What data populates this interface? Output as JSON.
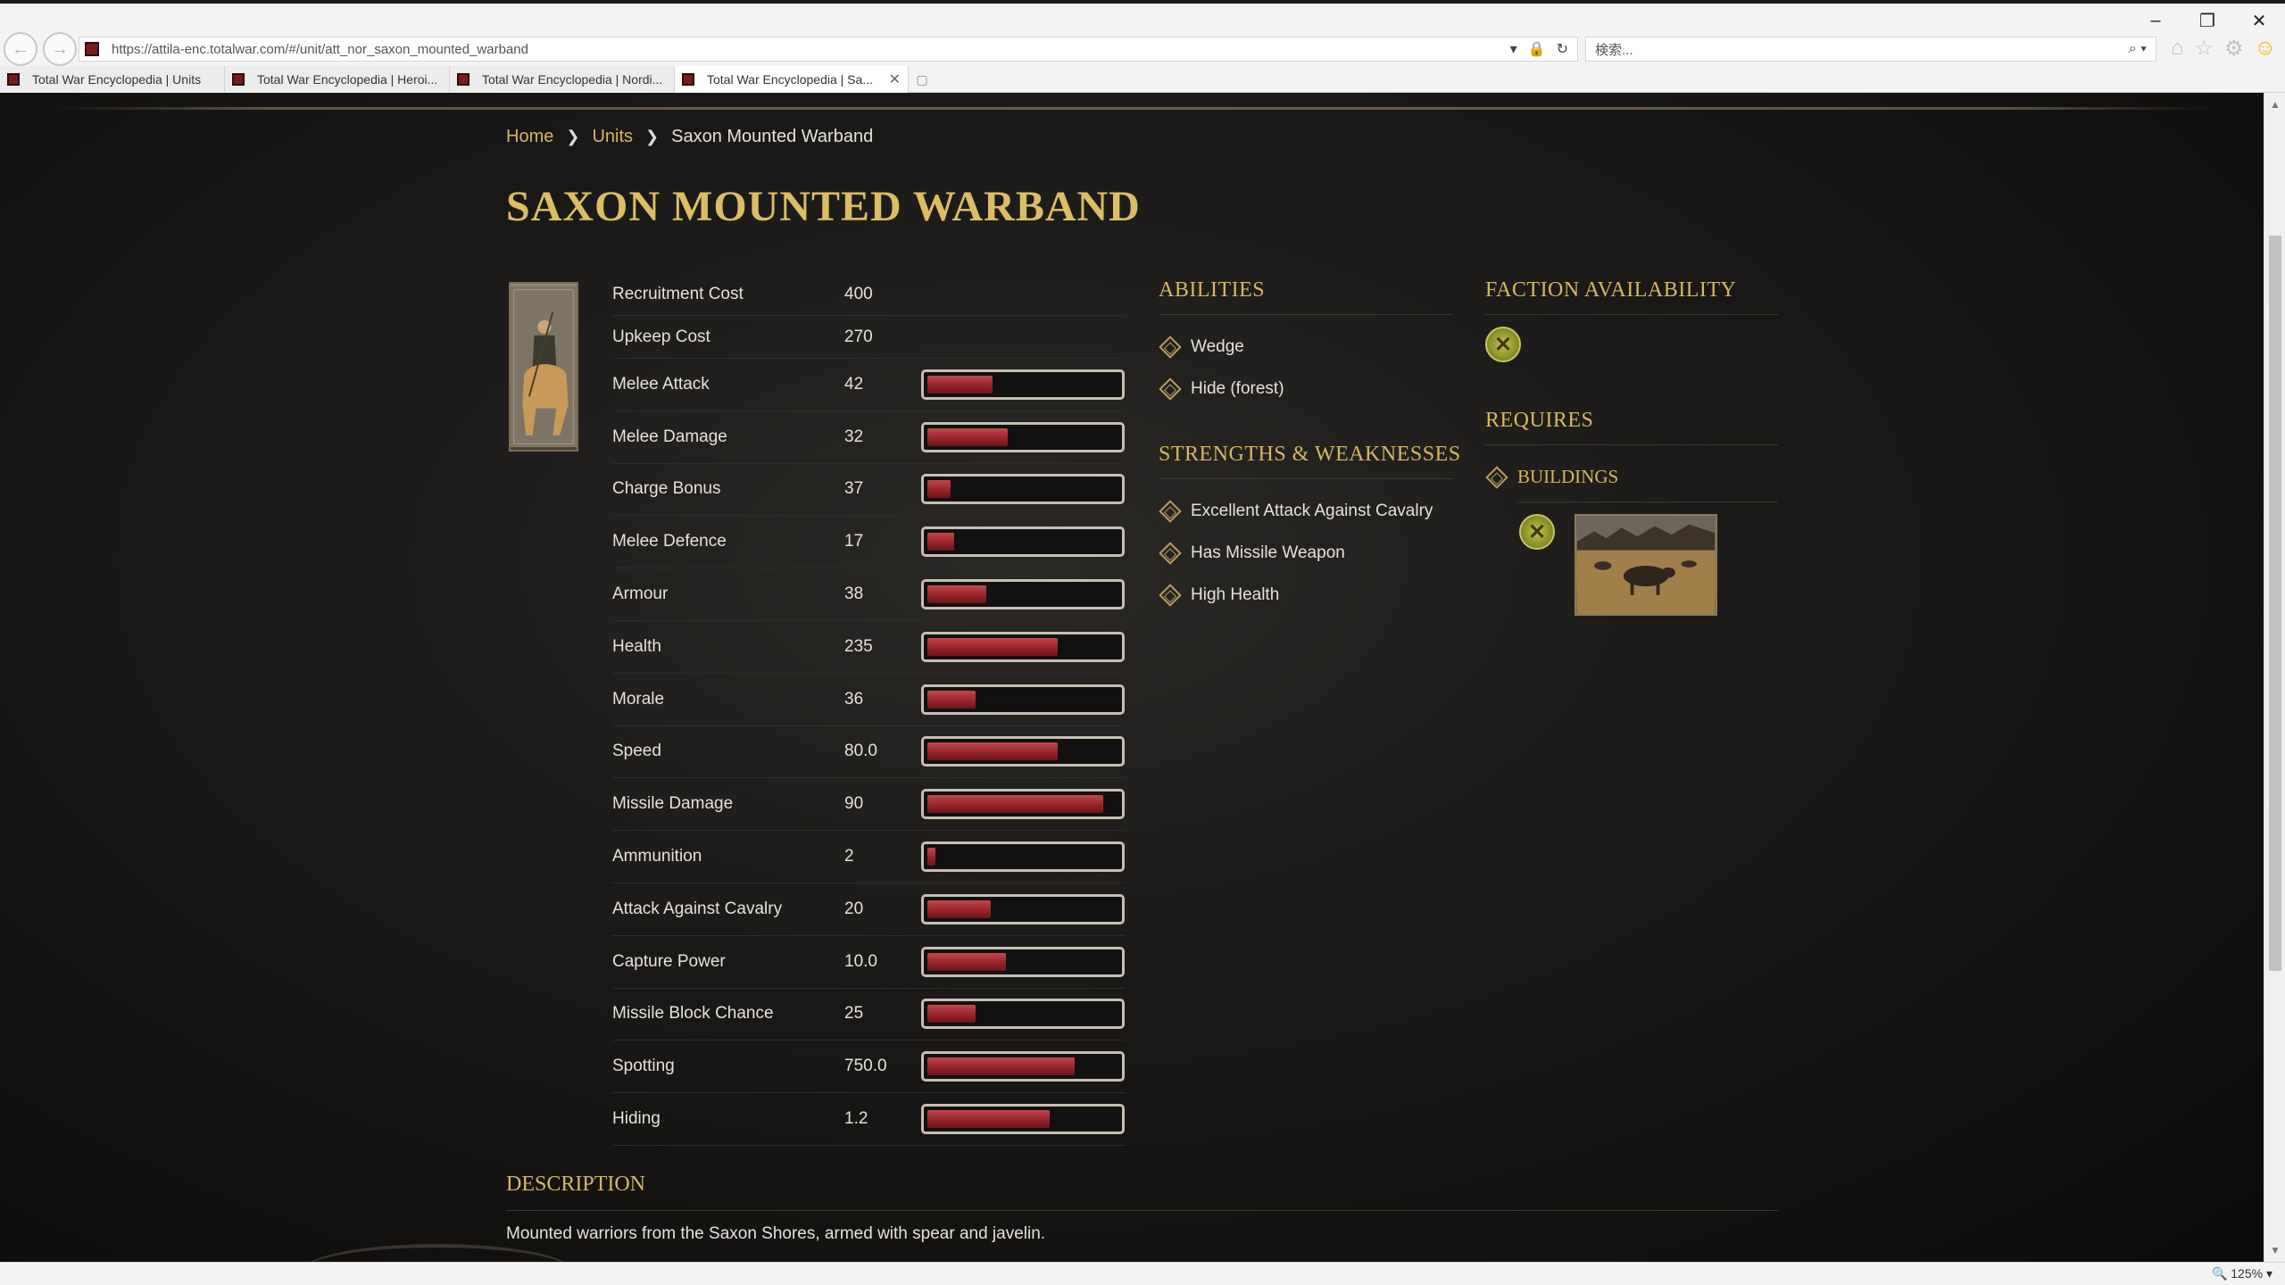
{
  "browser": {
    "url": "https://attila-enc.totalwar.com/#/unit/att_nor_saxon_mounted_warband",
    "search_placeholder": "検索...",
    "tabs": [
      {
        "label": "Total War Encyclopedia | Units"
      },
      {
        "label": "Total War Encyclopedia | Heroi..."
      },
      {
        "label": "Total War Encyclopedia | Nordi..."
      },
      {
        "label": "Total War Encyclopedia | Sa..."
      }
    ],
    "zoom": "125%"
  },
  "breadcrumb": {
    "home": "Home",
    "units": "Units",
    "current": "Saxon Mounted Warband"
  },
  "title": "SAXON MOUNTED WARBAND",
  "stats": [
    {
      "name": "Recruitment Cost",
      "value": "400"
    },
    {
      "name": "Upkeep Cost",
      "value": "270"
    },
    {
      "name": "Melee Attack",
      "value": "42",
      "fill": 0.34
    },
    {
      "name": "Melee Damage",
      "value": "32",
      "fill": 0.42
    },
    {
      "name": "Charge Bonus",
      "value": "37",
      "fill": 0.12
    },
    {
      "name": "Melee Defence",
      "value": "17",
      "fill": 0.14
    },
    {
      "name": "Armour",
      "value": "38",
      "fill": 0.31
    },
    {
      "name": "Health",
      "value": "235",
      "fill": 0.68
    },
    {
      "name": "Morale",
      "value": "36",
      "fill": 0.25
    },
    {
      "name": "Speed",
      "value": "80.0",
      "fill": 0.68
    },
    {
      "name": "Missile Damage",
      "value": "90",
      "fill": 0.92
    },
    {
      "name": "Ammunition",
      "value": "2",
      "fill": 0.04
    },
    {
      "name": "Attack Against Cavalry",
      "value": "20",
      "fill": 0.33
    },
    {
      "name": "Capture Power",
      "value": "10.0",
      "fill": 0.41
    },
    {
      "name": "Missile Block Chance",
      "value": "25",
      "fill": 0.25
    },
    {
      "name": "Spotting",
      "value": "750.0",
      "fill": 0.77
    },
    {
      "name": "Hiding",
      "value": "1.2",
      "fill": 0.64
    }
  ],
  "abilities": {
    "title": "ABILITIES",
    "items": [
      "Wedge",
      "Hide (forest)"
    ]
  },
  "strengths": {
    "title": "STRENGTHS & WEAKNESSES",
    "items": [
      "Excellent Attack Against Cavalry",
      "Has Missile Weapon",
      "High Health"
    ]
  },
  "faction": {
    "title": "FACTION AVAILABILITY"
  },
  "requires": {
    "title": "REQUIRES",
    "buildings_label": "BUILDINGS"
  },
  "description": {
    "title": "DESCRIPTION",
    "text": "Mounted warriors from the Saxon Shores, armed with spear and javelin."
  }
}
